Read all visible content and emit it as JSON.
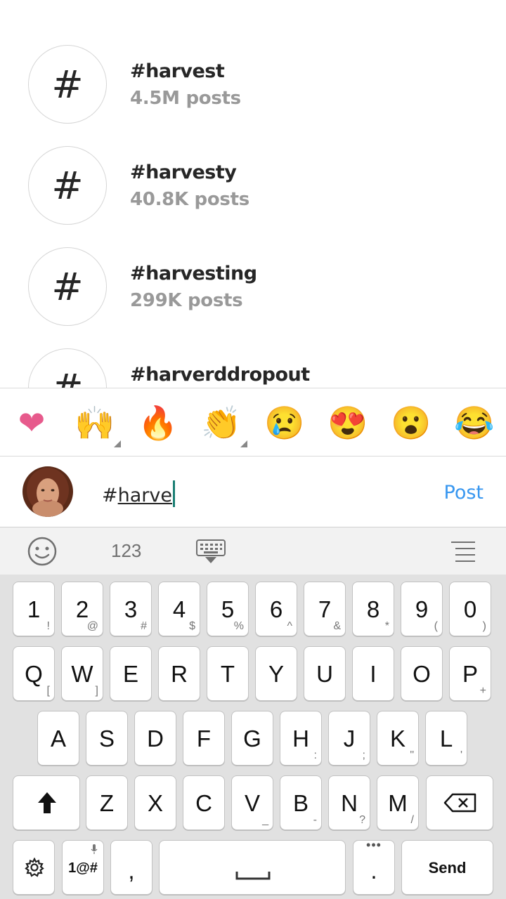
{
  "suggestions": [
    {
      "symbol": "#",
      "name": "#harvest",
      "count": "4.5M posts"
    },
    {
      "symbol": "#",
      "name": "#harvesty",
      "count": "40.8K posts"
    },
    {
      "symbol": "#",
      "name": "#harvesting",
      "count": "299K posts"
    },
    {
      "symbol": "#",
      "name": "#harverddropout",
      "count": ""
    }
  ],
  "emoji_bar": [
    {
      "icon": "heart-emoji",
      "glyph": "❤",
      "color": "#e75a8c",
      "has_variants": false
    },
    {
      "icon": "raising-hands-emoji",
      "glyph": "🙌",
      "has_variants": true
    },
    {
      "icon": "fire-emoji",
      "glyph": "🔥",
      "has_variants": false
    },
    {
      "icon": "clapping-hands-emoji",
      "glyph": "👏",
      "has_variants": true
    },
    {
      "icon": "sad-face-emoji",
      "glyph": "😢",
      "has_variants": false
    },
    {
      "icon": "heart-eyes-emoji",
      "glyph": "😍",
      "has_variants": false
    },
    {
      "icon": "surprised-face-emoji",
      "glyph": "😮",
      "has_variants": false
    },
    {
      "icon": "laughing-face-emoji",
      "glyph": "😂",
      "has_variants": false
    }
  ],
  "comment": {
    "hash": "#",
    "typed": "harve",
    "post_label": "Post",
    "post_color": "#3897f0"
  },
  "keyboard_toolbar": {
    "emoji_icon": "smiley-icon",
    "numbers_label": "123",
    "hide_icon": "keyboard-hide-icon",
    "menu_icon": "menu-lines-icon"
  },
  "keyboard": {
    "row1": [
      {
        "main": "1",
        "sub": "!"
      },
      {
        "main": "2",
        "sub": "@"
      },
      {
        "main": "3",
        "sub": "#"
      },
      {
        "main": "4",
        "sub": "$"
      },
      {
        "main": "5",
        "sub": "%"
      },
      {
        "main": "6",
        "sub": "^"
      },
      {
        "main": "7",
        "sub": "&"
      },
      {
        "main": "8",
        "sub": "*"
      },
      {
        "main": "9",
        "sub": "("
      },
      {
        "main": "0",
        "sub": ")"
      }
    ],
    "row2": [
      {
        "main": "Q",
        "sub": "["
      },
      {
        "main": "W",
        "sub": "]"
      },
      {
        "main": "E",
        "sub": ""
      },
      {
        "main": "R",
        "sub": ""
      },
      {
        "main": "T",
        "sub": ""
      },
      {
        "main": "Y",
        "sub": ""
      },
      {
        "main": "U",
        "sub": ""
      },
      {
        "main": "I",
        "sub": ""
      },
      {
        "main": "O",
        "sub": ""
      },
      {
        "main": "P",
        "sub": "+"
      }
    ],
    "row3": [
      {
        "main": "A",
        "sub": ""
      },
      {
        "main": "S",
        "sub": ""
      },
      {
        "main": "D",
        "sub": ""
      },
      {
        "main": "F",
        "sub": ""
      },
      {
        "main": "G",
        "sub": ""
      },
      {
        "main": "H",
        "sub": ":"
      },
      {
        "main": "J",
        "sub": ";"
      },
      {
        "main": "K",
        "sub": "\""
      },
      {
        "main": "L",
        "sub": "'"
      }
    ],
    "row4": [
      {
        "main": "Z",
        "sub": ""
      },
      {
        "main": "X",
        "sub": ""
      },
      {
        "main": "C",
        "sub": ""
      },
      {
        "main": "V",
        "sub": "_"
      },
      {
        "main": "B",
        "sub": "-"
      },
      {
        "main": "N",
        "sub": "?"
      },
      {
        "main": "M",
        "sub": "/"
      }
    ],
    "shift_icon": "shift-arrow-icon",
    "backspace_icon": "backspace-icon",
    "settings_icon": "gear-icon",
    "symbols_label": "1@#",
    "mic_icon": "microphone-icon",
    "comma_label": ",",
    "period_label": ".",
    "more_icon": "ellipsis-icon",
    "space_icon": "space-bar-icon",
    "send_label": "Send"
  }
}
